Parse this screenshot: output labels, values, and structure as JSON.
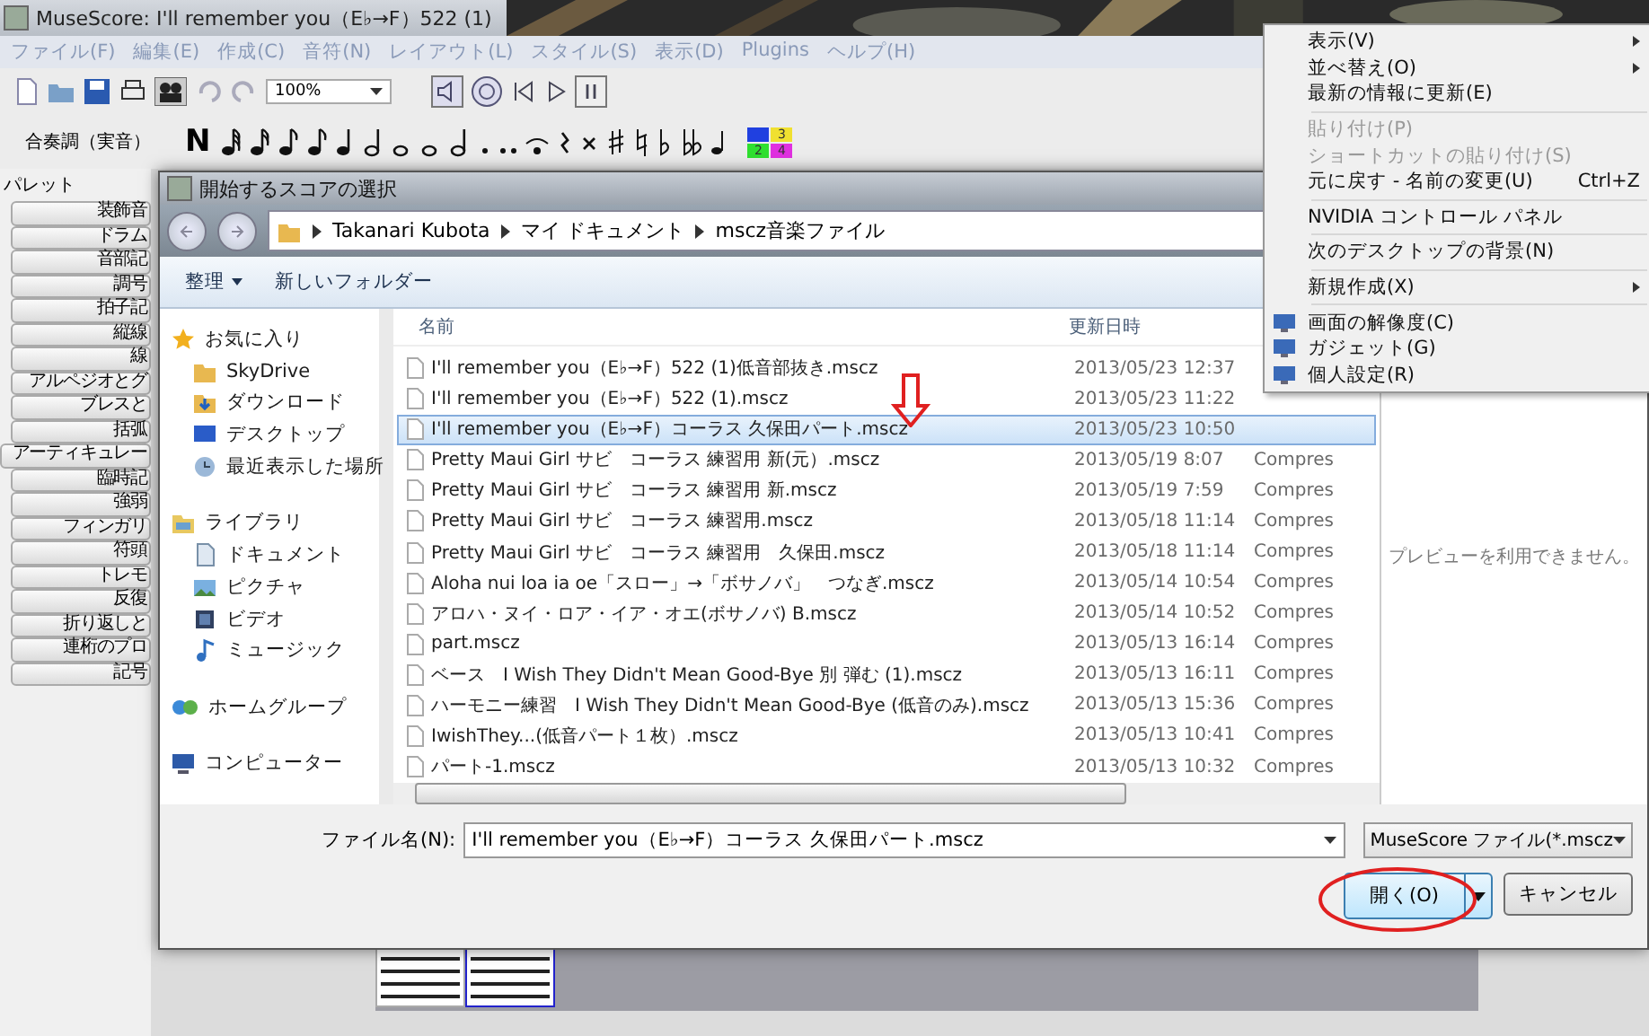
{
  "app": {
    "title": "MuseScore: I'll remember you（E♭→F）522 (1)",
    "menu": [
      "ファイル(F)",
      "編集(E)",
      "作成(C)",
      "音符(N)",
      "レイアウト(L)",
      "スタイル(S)",
      "表示(D)",
      "Plugins",
      "ヘルプ(H)"
    ],
    "zoom": "100%",
    "concert_pitch": "合奏調（実音）",
    "note_input": "N",
    "voices": [
      {
        "color": "#2040e0"
      },
      {
        "label": "3",
        "color": "#f0e030"
      },
      {
        "label": "2",
        "color": "#30e030"
      },
      {
        "label": "4",
        "color": "#e030e0"
      }
    ],
    "palette": {
      "title": "パレット",
      "items": [
        "装飾音",
        "ドラム",
        "音部記",
        "調号",
        "拍子記",
        "縦線",
        "線",
        "アルペジオとグ",
        "ブレスと",
        "括弧",
        "アーティキュレー",
        "臨時記",
        "強弱",
        "フィンガリ",
        "符頭",
        "トレモ",
        "反復",
        "折り返しと",
        "連桁のプロ",
        "記号"
      ]
    }
  },
  "dialog": {
    "title": "開始するスコアの選択",
    "breadcrumb": [
      "Takanari Kubota",
      "マイ ドキュメント",
      "mscz音楽ファイル"
    ],
    "toolbar": [
      {
        "label": "整理",
        "dropdown": true
      },
      {
        "label": "新しいフォルダー",
        "dropdown": false
      }
    ],
    "navigation": [
      {
        "label": "お気に入り",
        "kind": "favorites",
        "children": [
          {
            "label": "SkyDrive",
            "kind": "folder"
          },
          {
            "label": "ダウンロード",
            "kind": "download"
          },
          {
            "label": "デスクトップ",
            "kind": "desktop"
          },
          {
            "label": "最近表示した場所",
            "kind": "recent"
          }
        ]
      },
      {
        "label": "ライブラリ",
        "kind": "library",
        "children": [
          {
            "label": "ドキュメント",
            "kind": "document"
          },
          {
            "label": "ピクチャ",
            "kind": "picture"
          },
          {
            "label": "ビデオ",
            "kind": "video"
          },
          {
            "label": "ミュージック",
            "kind": "music"
          }
        ]
      },
      {
        "label": "ホームグループ",
        "kind": "homegroup"
      },
      {
        "label": "コンピューター",
        "kind": "computer"
      }
    ],
    "columns": [
      "名前",
      "更新日時"
    ],
    "files": [
      {
        "name": "I'll remember you（E♭→F）522 (1)低音部抜き.mscz",
        "modified": "2013/05/23 12:37",
        "selected": false
      },
      {
        "name": "I'll remember you（E♭→F）522 (1).mscz",
        "modified": "2013/05/23 11:22",
        "selected": false
      },
      {
        "name": "I'll remember you（E♭→F）コーラス 久保田パート.mscz",
        "modified": "2013/05/23 10:50",
        "selected": true
      },
      {
        "name": "Pretty Maui Girl サビ　コーラス 練習用 新(元）.mscz",
        "modified": "2013/05/19 8:07",
        "type": "Compres",
        "selected": false
      },
      {
        "name": "Pretty Maui Girl サビ　コーラス 練習用 新.mscz",
        "modified": "2013/05/19 7:59",
        "type": "Compres",
        "selected": false
      },
      {
        "name": "Pretty Maui Girl サビ　コーラス 練習用.mscz",
        "modified": "2013/05/18 11:14",
        "type": "Compres",
        "selected": false
      },
      {
        "name": "Pretty Maui Girl サビ　コーラス 練習用　久保田.mscz",
        "modified": "2013/05/18 11:14",
        "type": "Compres",
        "selected": false
      },
      {
        "name": "Aloha nui loa ia oe「スロー」→「ボサノバ」　つなぎ.mscz",
        "modified": "2013/05/14 10:54",
        "type": "Compres",
        "selected": false
      },
      {
        "name": "アロハ・ヌイ・ロア・イア・オエ(ボサノバ) B.mscz",
        "modified": "2013/05/14 10:52",
        "type": "Compres",
        "selected": false
      },
      {
        "name": "part.mscz",
        "modified": "2013/05/13 16:14",
        "type": "Compres",
        "selected": false
      },
      {
        "name": "ベース　I Wish They Didn't Mean Good-Bye 別 弾む (1).mscz",
        "modified": "2013/05/13 16:11",
        "type": "Compres",
        "selected": false
      },
      {
        "name": "ハーモニー練習　I Wish They Didn't Mean Good-Bye (低音のみ).mscz",
        "modified": "2013/05/13 15:36",
        "type": "Compres",
        "selected": false
      },
      {
        "name": "IwishThey...(低音パート１枚）.mscz",
        "modified": "2013/05/13 10:41",
        "type": "Compres",
        "selected": false
      },
      {
        "name": "パート-1.mscz",
        "modified": "2013/05/13 10:32",
        "type": "Compres",
        "selected": false
      }
    ],
    "preview": "プレビューを利用できません。",
    "filename_label": "ファイル名(N):",
    "filename": "I'll remember you（E♭→F）コーラス 久保田パート.mscz",
    "filter": "MuseScore ファイル(*.mscz",
    "open_button": "開く(O)",
    "cancel_button": "キャンセル"
  },
  "context_menu": [
    {
      "label": "表示(V)",
      "kind": "submenu",
      "disabled": false
    },
    {
      "label": "並べ替え(O)",
      "kind": "submenu",
      "disabled": false
    },
    {
      "label": "最新の情報に更新(E)",
      "kind": "item",
      "disabled": false
    },
    {
      "kind": "separator"
    },
    {
      "label": "貼り付け(P)",
      "kind": "item",
      "disabled": true
    },
    {
      "label": "ショートカットの貼り付け(S)",
      "kind": "item",
      "disabled": true
    },
    {
      "label": "元に戻す - 名前の変更(U)",
      "kind": "item",
      "disabled": false,
      "shortcut": "Ctrl+Z"
    },
    {
      "kind": "separator"
    },
    {
      "label": "NVIDIA コントロール パネル",
      "kind": "item",
      "disabled": false
    },
    {
      "kind": "separator"
    },
    {
      "label": "次のデスクトップの背景(N)",
      "kind": "item",
      "disabled": false
    },
    {
      "kind": "separator"
    },
    {
      "label": "新規作成(X)",
      "kind": "submenu",
      "disabled": false
    },
    {
      "kind": "separator"
    },
    {
      "label": "画面の解像度(C)",
      "kind": "icon",
      "disabled": false
    },
    {
      "label": "ガジェット(G)",
      "kind": "icon",
      "disabled": false
    },
    {
      "label": "個人設定(R)",
      "kind": "icon",
      "disabled": false
    }
  ]
}
